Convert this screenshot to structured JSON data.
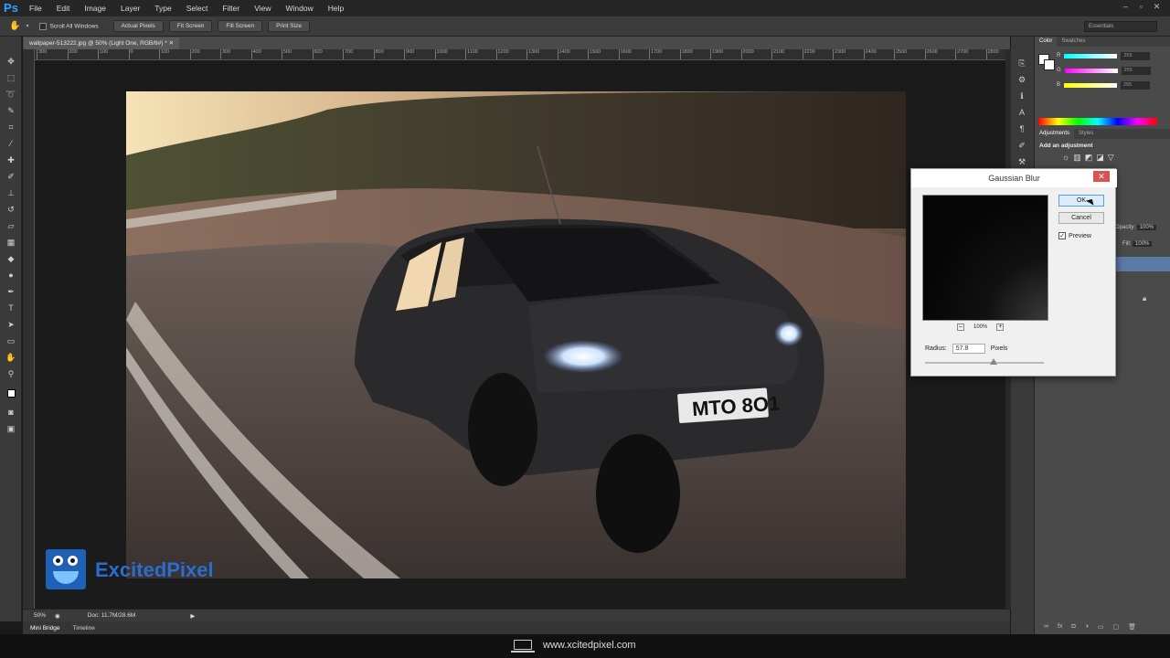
{
  "app": {
    "logo": "Ps"
  },
  "menu": [
    "File",
    "Edit",
    "Image",
    "Layer",
    "Type",
    "Select",
    "Filter",
    "View",
    "Window",
    "Help"
  ],
  "options_bar": {
    "scroll_all_label": "Scroll All Windows",
    "buttons": [
      "Actual Pixels",
      "Fit Screen",
      "Fill Screen",
      "Print Size"
    ],
    "workspace": "Essentials"
  },
  "document": {
    "tab_title": "wallpaper-513222.jpg @ 50% (Light One, RGB/8#) *",
    "ruler_ticks": [
      "300",
      "200",
      "100",
      "0",
      "100",
      "200",
      "300",
      "400",
      "500",
      "600",
      "700",
      "800",
      "900",
      "1000",
      "1100",
      "1200",
      "1300",
      "1400",
      "1500",
      "1600",
      "1700",
      "1800",
      "1900",
      "2000",
      "2100",
      "2200",
      "2300",
      "2400",
      "2500",
      "2600",
      "2700",
      "2800"
    ],
    "plate": "MTO 8O1"
  },
  "status": {
    "zoom": "50%",
    "doc": "Doc: 11.7M/28.6M"
  },
  "bottom_tabs": [
    "Mini Bridge",
    "Timeline"
  ],
  "panels": {
    "color_tabs": [
      "Color",
      "Swatches"
    ],
    "channels": [
      {
        "label": "R",
        "value": "255"
      },
      {
        "label": "G",
        "value": "255"
      },
      {
        "label": "B",
        "value": "255"
      }
    ],
    "adjust_tabs": [
      "Adjustments",
      "Styles"
    ],
    "adjust_title": "Add an adjustment",
    "layers_opacity_label": "Opacity:",
    "layers_opacity_value": "100%",
    "layers_fill_label": "Fill:",
    "layers_fill_value": "100%"
  },
  "dialog": {
    "title": "Gaussian Blur",
    "close": "✕",
    "ok": "OK",
    "cancel": "Cancel",
    "preview_label": "Preview",
    "preview_checked": "✓",
    "zoom": "100%",
    "radius_label": "Radius:",
    "radius_value": "57.8",
    "radius_unit": "Pixels"
  },
  "watermark": {
    "brand": "ExcitedPixel"
  },
  "footer": {
    "url": "www.xcitedpixel.com"
  }
}
